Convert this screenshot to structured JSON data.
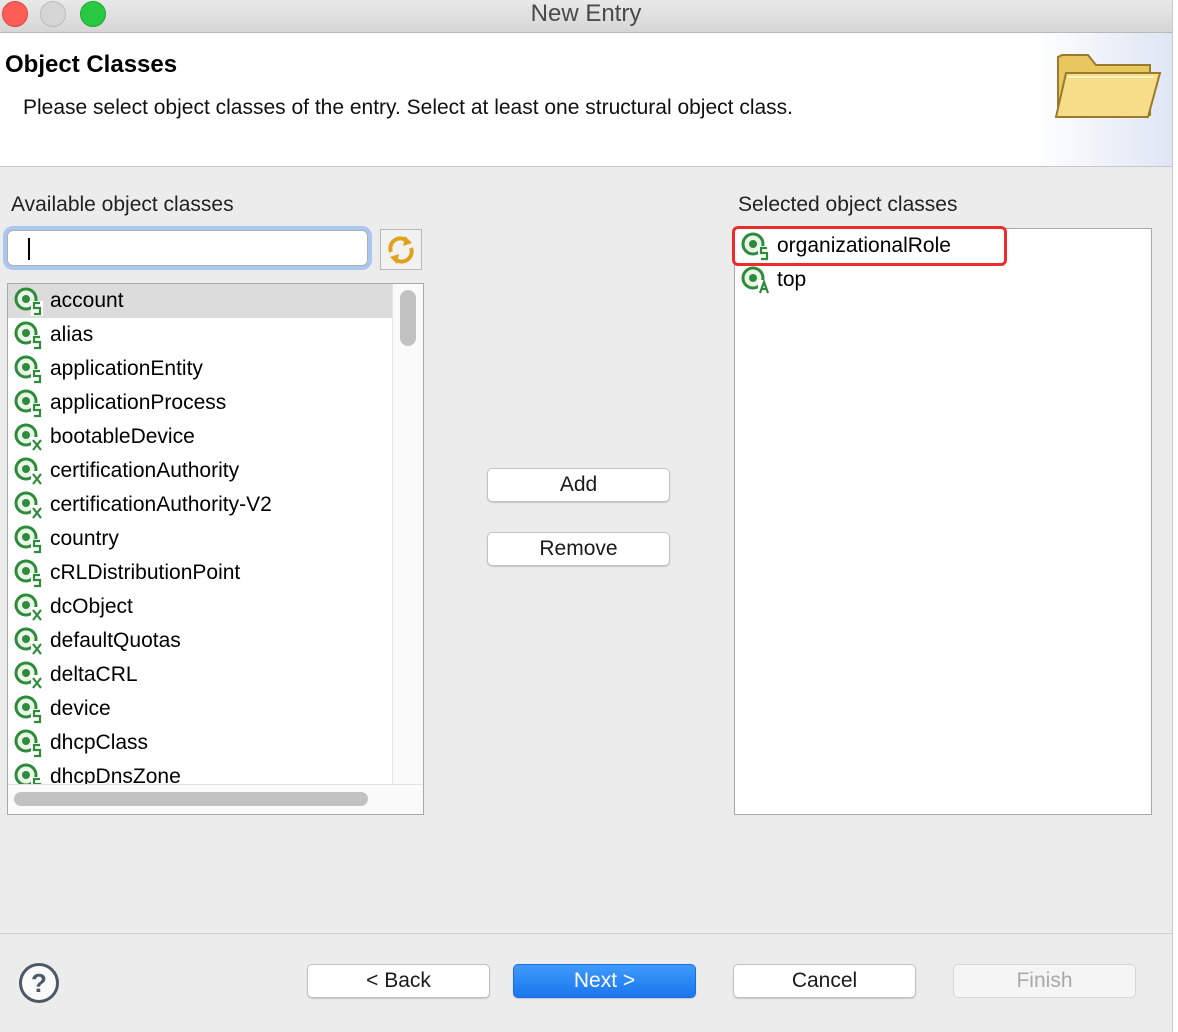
{
  "window": {
    "title": "New Entry"
  },
  "header": {
    "title": "Object Classes",
    "description": "Please select object classes of the entry. Select at least one structural object class."
  },
  "available": {
    "label": "Available object classes",
    "filter_value": "",
    "items": [
      {
        "label": "account",
        "kind": "S"
      },
      {
        "label": "alias",
        "kind": "S"
      },
      {
        "label": "applicationEntity",
        "kind": "S"
      },
      {
        "label": "applicationProcess",
        "kind": "S"
      },
      {
        "label": "bootableDevice",
        "kind": "X"
      },
      {
        "label": "certificationAuthority",
        "kind": "X"
      },
      {
        "label": "certificationAuthority-V2",
        "kind": "X"
      },
      {
        "label": "country",
        "kind": "S"
      },
      {
        "label": "cRLDistributionPoint",
        "kind": "S"
      },
      {
        "label": "dcObject",
        "kind": "X"
      },
      {
        "label": "defaultQuotas",
        "kind": "X"
      },
      {
        "label": "deltaCRL",
        "kind": "X"
      },
      {
        "label": "device",
        "kind": "S"
      },
      {
        "label": "dhcpClass",
        "kind": "S"
      },
      {
        "label": "dhcpDnsZone",
        "kind": "S"
      }
    ]
  },
  "selected": {
    "label": "Selected object classes",
    "items": [
      {
        "label": "organizationalRole",
        "kind": "S"
      },
      {
        "label": "top",
        "kind": "A"
      }
    ]
  },
  "actions": {
    "add": "Add",
    "remove": "Remove"
  },
  "footer": {
    "help": "?",
    "back": "< Back",
    "next": "Next >",
    "cancel": "Cancel",
    "finish": "Finish"
  },
  "colors": {
    "accent": "#1a76f0",
    "highlight": "#ee2b2b",
    "icon_green": "#2e8b3a"
  }
}
